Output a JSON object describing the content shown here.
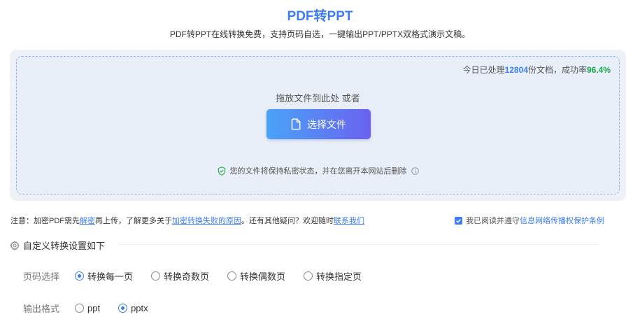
{
  "header": {
    "title": "PDF转PPT",
    "subtitle": "PDF转PPT在线转换免费，支持页码自选，一键输出PPT/PPTX双格式演示文稿。"
  },
  "upload": {
    "stats_prefix": "今日已处理",
    "stats_count": "12804",
    "stats_middle": "份文档，成功率",
    "stats_rate": "96.4%",
    "drop_hint": "拖放文件到此处 或者",
    "select_label": "选择文件",
    "privacy_text": "您的文件将保持私密状态，并在您离开本网站后删除"
  },
  "notice": {
    "t1": "注意：加密PDF需先",
    "link_decrypt": "解密",
    "t2": "再上传，了解更多关于",
    "link_fail": "加密转换失败的原因",
    "t3": "。还有其他疑问？欢迎随时",
    "link_contact": "联系我们"
  },
  "agreement": {
    "prefix": "我已阅读并遵守",
    "link": "信息网络传播权保护条例",
    "checked": true
  },
  "settings": {
    "title": "自定义转换设置如下",
    "page_label": "页码选择",
    "page_options": [
      "转换每一页",
      "转换奇数页",
      "转换偶数页",
      "转换指定页"
    ],
    "format_label": "输出格式",
    "format_options": [
      "ppt",
      "pptx"
    ]
  },
  "colors": {
    "accent": "#3d7cf5",
    "success": "#18a84a"
  },
  "icons": {
    "file": "file-icon",
    "shield": "shield-check-icon",
    "info": "info-icon",
    "gear": "gear-icon"
  }
}
